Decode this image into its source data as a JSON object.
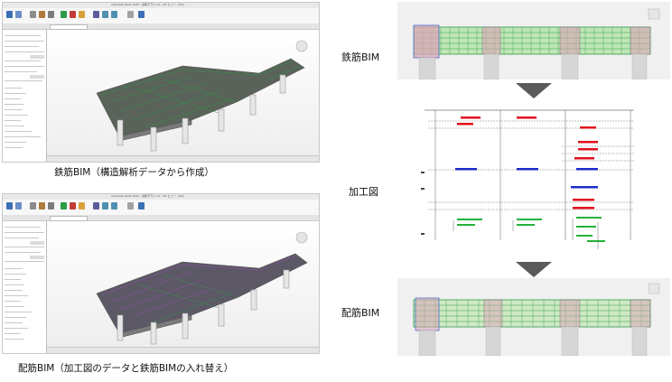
{
  "captions": {
    "top_left": "鉄筋BIM（構造解析データから作成）",
    "bottom_left": "配筋BIM（加工図のデータと鉄筋BIMの入れ替え）"
  },
  "labels": {
    "rebar_bim": "鉄筋BIM",
    "fabrication_drawing": "加工図",
    "placement_bim": "配筋BIM"
  },
  "window": {
    "title": "Autodesk Revit 2020 - 鉄筋モデル.rvt - 3D ビュー: {3D}"
  },
  "colors": {
    "arrow": "#5a5a5a",
    "rebar_green": "#2e9c46",
    "column_pink": "#d9a3b6",
    "fab_red": "#e0101c",
    "fab_blue": "#1c2cc8",
    "fab_green": "#23b23a"
  }
}
